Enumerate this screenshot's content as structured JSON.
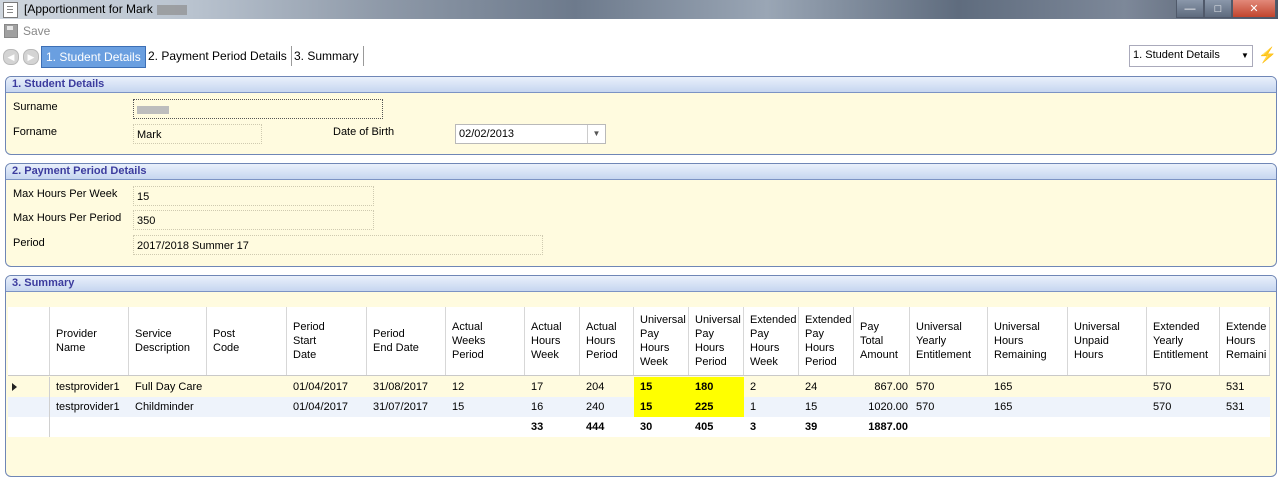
{
  "window": {
    "title": "[Apportionment for Mark",
    "controls": [
      "minimize",
      "maximize",
      "close"
    ]
  },
  "toolbar": {
    "save_label": "Save"
  },
  "nav": {
    "tabs": [
      {
        "label": "1. Student Details",
        "active": true
      },
      {
        "label": "2. Payment Period Details",
        "active": false
      },
      {
        "label": "3. Summary",
        "active": false
      }
    ],
    "jump_select": "1. Student Details"
  },
  "student": {
    "heading": "1. Student Details",
    "surname_label": "Surname",
    "forename_label": "Forname",
    "forename_value": "Mark",
    "dob_label": "Date of Birth",
    "dob_value": "02/02/2013"
  },
  "payment": {
    "heading": "2. Payment Period Details",
    "max_week_label": "Max Hours Per Week",
    "max_week_value": "15",
    "max_period_label": "Max Hours Per Period",
    "max_period_value": "350",
    "period_label": "Period",
    "period_value": "2017/2018 Summer 17"
  },
  "summary": {
    "heading": "3. Summary",
    "columns": [
      "Provider\nName",
      "Service\nDescription",
      "Post\nCode",
      "Period\nStart\nDate",
      "Period\nEnd Date",
      "Actual\nWeeks\nPeriod",
      "Actual\nHours\nWeek",
      "Actual\nHours\nPeriod",
      "Universal\nPay\nHours\nWeek",
      "Universal\nPay\nHours\nPeriod",
      "Extended\nPay\nHours\nWeek",
      "Extended\nPay\nHours\nPeriod",
      "Pay\nTotal\nAmount",
      "Universal\nYearly\nEntitlement",
      "Universal\nHours\nRemaining",
      "Universal\nUnpaid\nHours",
      "Extended\nYearly\nEntitlement",
      "Extende\nHours\nRemaini"
    ],
    "rows": [
      [
        "testprovider1",
        "Full Day Care",
        "",
        "01/04/2017",
        "31/08/2017",
        "12",
        "17",
        "204",
        "15",
        "180",
        "2",
        "24",
        "867.00",
        "570",
        "165",
        "",
        "570",
        "531"
      ],
      [
        "testprovider1",
        "Childminder",
        "",
        "01/04/2017",
        "31/07/2017",
        "15",
        "16",
        "240",
        "15",
        "225",
        "1",
        "15",
        "1020.00",
        "570",
        "165",
        "",
        "570",
        "531"
      ]
    ],
    "totals": [
      "",
      "",
      "",
      "",
      "",
      "",
      "33",
      "444",
      "30",
      "405",
      "3",
      "39",
      "1887.00",
      "",
      "",
      "",
      "",
      ""
    ],
    "highlight_color": "#ffff00"
  }
}
